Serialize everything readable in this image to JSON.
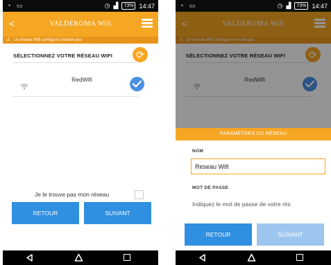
{
  "status_bar": {
    "time": "14:47",
    "battery": "73%"
  },
  "app": {
    "title": "VALDEROMA Wifi",
    "warning": "Le réseau Wifi configuré n'existe pas"
  },
  "wifi_select": {
    "section_title": "SÉLECTIONNEZ VOTRE RÉSEAU WIFI",
    "networks": [
      {
        "name": "RedWifi",
        "selected": true
      }
    ],
    "not_found_label": "Je le trouve pas mon réseau",
    "not_found_checked": false
  },
  "buttons": {
    "back": "RETOUR",
    "next": "SUIVANT"
  },
  "network_dialog": {
    "title": "PARAMÈTRES DU RÉSEAU",
    "name_label": "NOM",
    "name_value": "Reseau Wifi",
    "password_label": "MOT DE PASSE",
    "password_placeholder": "Indiquez le mot de passe de votre rés"
  },
  "colors": {
    "accent": "#f5a623",
    "primary": "#2f8fe0",
    "selected": "#4a90e2",
    "warning": "#e8941a"
  },
  "icons": [
    "back-arrow-icon",
    "menu-icon",
    "warning-icon",
    "refresh-icon",
    "wifi-icon",
    "check-icon",
    "nav-back-icon",
    "nav-home-icon",
    "nav-recent-icon"
  ]
}
